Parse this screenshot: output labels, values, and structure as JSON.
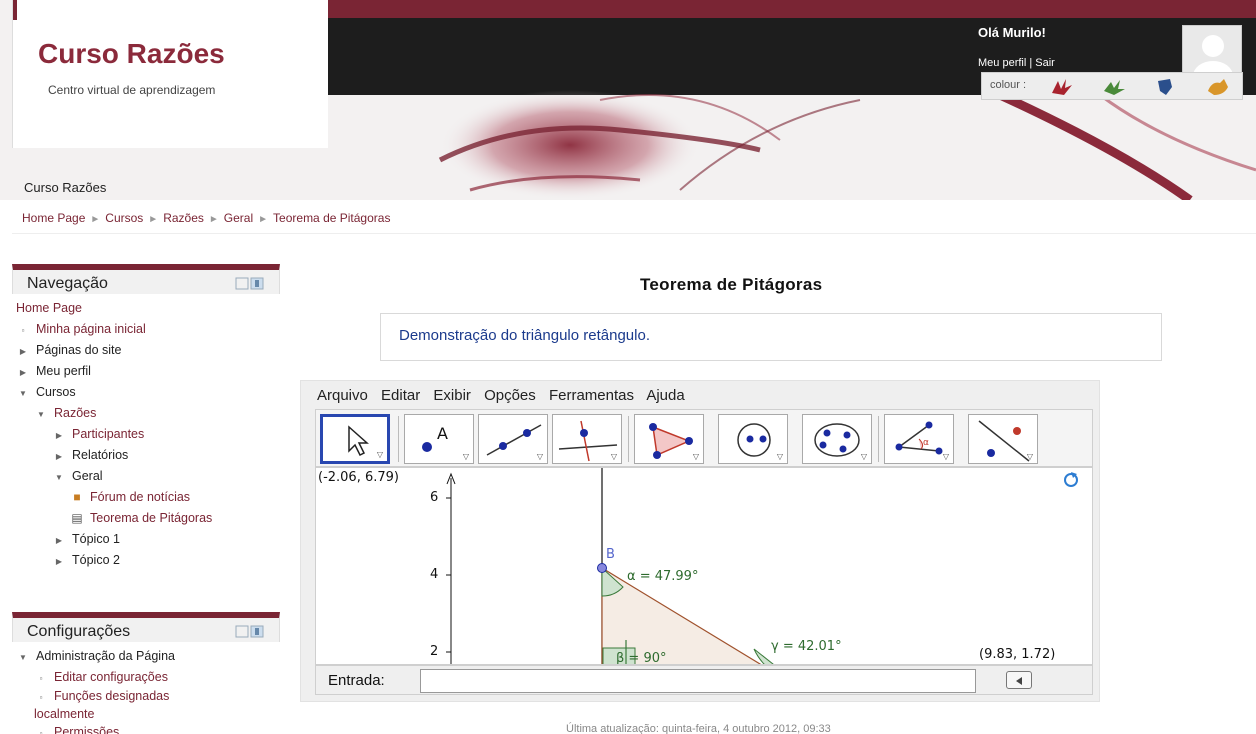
{
  "header": {
    "site_title": "Curso Razões",
    "site_subtitle": "Centro virtual de aprendizagem",
    "course_name": "Curso Razões",
    "greeting": "Olá Murilo!",
    "profile_link": "Meu perfil",
    "separator": "|",
    "logout_link": "Sair",
    "colour_label": "colour :",
    "colours": [
      "#a8232e",
      "#4a8a3a",
      "#2b4f8c",
      "#d9962a"
    ],
    "accent_color": "#7a2534"
  },
  "breadcrumb": {
    "items": [
      "Home Page",
      "Cursos",
      "Razões",
      "Geral",
      "Teorema de Pitágoras"
    ],
    "separator": "►"
  },
  "navigation": {
    "title": "Navegação",
    "items": [
      {
        "label": "Home Page",
        "level": 0,
        "icon": "none",
        "link": true
      },
      {
        "label": "Minha página inicial",
        "level": 0,
        "icon": "bullet",
        "link": true
      },
      {
        "label": "Páginas do site",
        "level": 0,
        "icon": "collapsed",
        "link": false
      },
      {
        "label": "Meu perfil",
        "level": 0,
        "icon": "collapsed",
        "link": false
      },
      {
        "label": "Cursos",
        "level": 0,
        "icon": "expanded",
        "link": false
      },
      {
        "label": "Razões",
        "level": 1,
        "icon": "expanded",
        "link": true
      },
      {
        "label": "Participantes",
        "level": 2,
        "icon": "collapsed",
        "link": true
      },
      {
        "label": "Relatórios",
        "level": 2,
        "icon": "collapsed",
        "link": false
      },
      {
        "label": "Geral",
        "level": 2,
        "icon": "expanded",
        "link": false
      },
      {
        "label": "Fórum de notícias",
        "level": 3,
        "icon": "forum-icon",
        "link": true
      },
      {
        "label": "Teorema de Pitágoras",
        "level": 3,
        "icon": "page-icon",
        "link": true
      },
      {
        "label": "Tópico 1",
        "level": 2,
        "icon": "collapsed",
        "link": false
      },
      {
        "label": "Tópico 2",
        "level": 2,
        "icon": "collapsed",
        "link": false
      }
    ]
  },
  "settings": {
    "title": "Configurações",
    "items": [
      {
        "label": "Administração da Página",
        "level": 0,
        "icon": "expanded",
        "link": false
      },
      {
        "label": "Editar configurações",
        "level": 1,
        "icon": "bullet",
        "link": true
      },
      {
        "label": "Funções designadas localmente",
        "level": 1,
        "icon": "bullet",
        "link": true
      },
      {
        "label": "Permissões",
        "level": 1,
        "icon": "bullet",
        "link": true
      }
    ]
  },
  "main": {
    "heading": "Teorema de Pitágoras",
    "summary": "Demonstração do triângulo retângulo."
  },
  "geogebra": {
    "menu": [
      "Arquivo",
      "Editar",
      "Exibir",
      "Opções",
      "Ferramentas",
      "Ajuda"
    ],
    "tools": [
      "move-tool",
      "point-tool",
      "line-tool",
      "perpendicular-tool",
      "polygon-tool",
      "circle-tool",
      "ellipse-tool",
      "angle-tool",
      "reflect-tool"
    ],
    "view": {
      "top_left_coord": "(-2.06, 6.79)",
      "bottom_right_coord": "(9.83, 1.72)",
      "y_ticks": [
        "6",
        "4",
        "2"
      ],
      "point_label": "B",
      "angle_alpha": "α = 47.99°",
      "angle_gamma": "γ = 42.01°",
      "angle_beta": "β = 90°"
    },
    "input_label": "Entrada:",
    "input_value": ""
  },
  "footer": {
    "last_updated": "Última atualização: quinta-feira, 4 outubro 2012, 09:33"
  }
}
